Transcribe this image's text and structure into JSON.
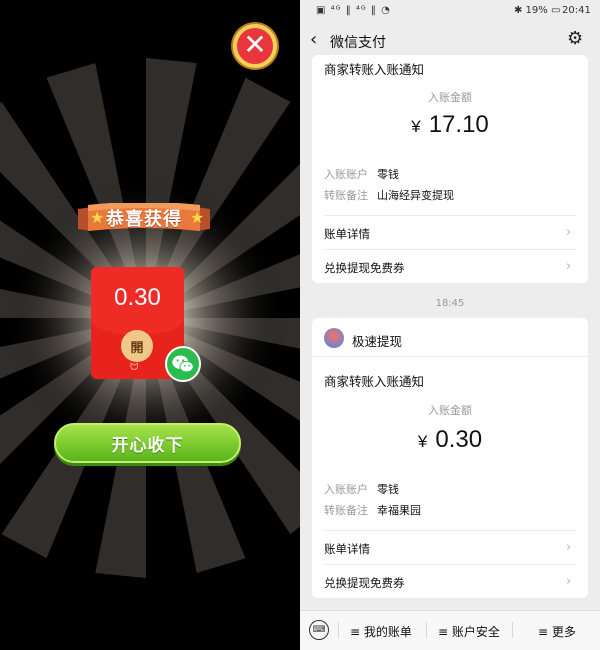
{
  "left": {
    "close_icon": "close-x-icon",
    "ribbon_text": "恭喜获得",
    "packet_amount": "0.30",
    "open_label": "開",
    "wechat_icon": "wechat-icon",
    "collect_button": "开心收下",
    "colors": {
      "accent_red": "#e8231e",
      "button_green": "#59b51b",
      "ribbon_orange": "#e9793b"
    }
  },
  "right": {
    "status": {
      "left_icons": "▣ ⁴ᴳ ‖ ⁴ᴳ ‖ ◔",
      "battery": "✱ 19% ▭",
      "time": "20:41"
    },
    "nav": {
      "back_icon": "‹",
      "title": "微信支付",
      "settings_icon": "⚙"
    },
    "card1": {
      "title": "商家转账入账通知",
      "amount_label": "入账金额",
      "currency": "¥",
      "amount": "17.10",
      "fields": [
        {
          "label": "入账账户",
          "value": "零钱"
        },
        {
          "label": "转账备注",
          "value": "山海经异变提现"
        }
      ],
      "rows": [
        {
          "label": "账单详情"
        },
        {
          "label": "兑换提现免费券"
        }
      ]
    },
    "timestamp": "18:45",
    "card2": {
      "app_name": "极速提现",
      "title": "商家转账入账通知",
      "amount_label": "入账金额",
      "currency": "¥",
      "amount": "0.30",
      "fields": [
        {
          "label": "入账账户",
          "value": "零钱"
        },
        {
          "label": "转账备注",
          "value": "幸福果园"
        }
      ],
      "rows": [
        {
          "label": "账单详情"
        },
        {
          "label": "兑换提现免费券"
        }
      ]
    },
    "bottom": {
      "keyboard_icon": "keyboard-icon",
      "tabs": [
        {
          "label": "≡ 我的账单"
        },
        {
          "label": "≡ 账户安全"
        },
        {
          "label": "≡ 更多"
        }
      ]
    },
    "chevron": "›"
  }
}
